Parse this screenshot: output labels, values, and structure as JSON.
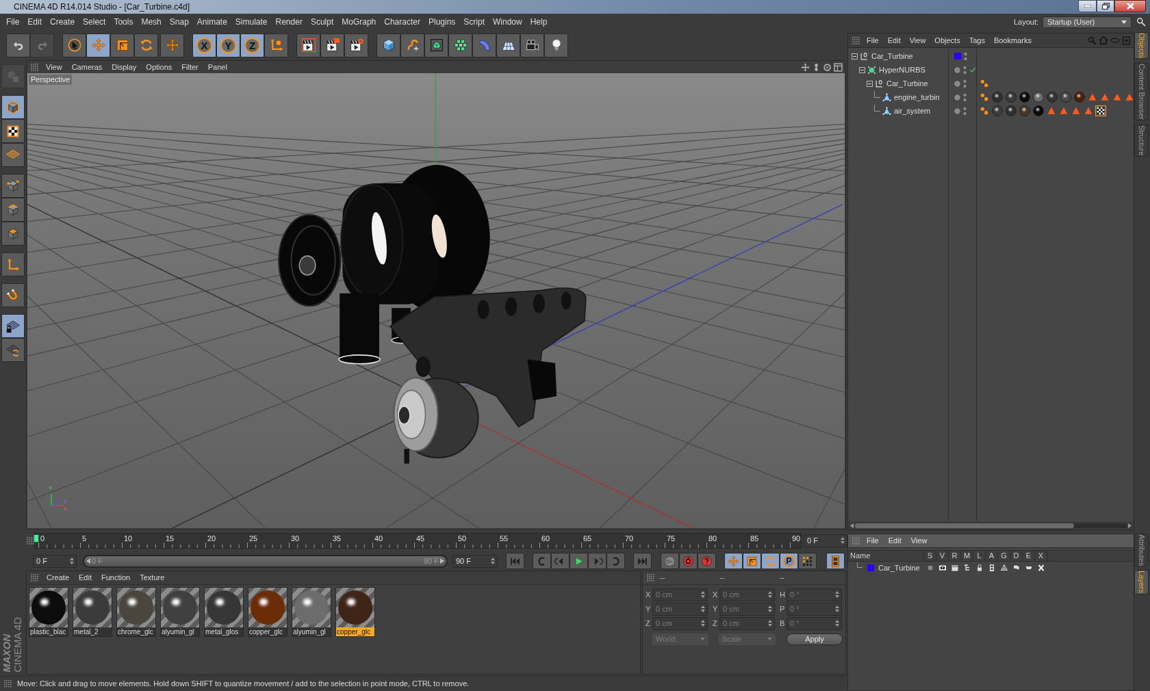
{
  "window": {
    "title": "CINEMA 4D R14.014 Studio - [Car_Turbine.c4d]"
  },
  "menu_bar": [
    "File",
    "Edit",
    "Create",
    "Select",
    "Tools",
    "Mesh",
    "Snap",
    "Animate",
    "Simulate",
    "Render",
    "Sculpt",
    "MoGraph",
    "Character",
    "Plugins",
    "Script",
    "Window",
    "Help"
  ],
  "layout": {
    "label": "Layout:",
    "value": "Startup (User)"
  },
  "toolbar": [
    [
      {
        "selected": false,
        "disabled": false
      },
      {
        "selected": false,
        "disabled": true
      }
    ],
    [
      {
        "selected": false,
        "disabled": false
      },
      {
        "selected": true,
        "disabled": false
      },
      {
        "selected": false,
        "disabled": false
      },
      {
        "selected": false,
        "disabled": false
      }
    ],
    [
      {
        "selected": false,
        "disabled": false
      }
    ],
    [
      {
        "label": "X",
        "selected": true,
        "disabled": false
      },
      {
        "label": "Y",
        "selected": true,
        "disabled": false
      },
      {
        "label": "Z",
        "selected": true,
        "disabled": false
      },
      {
        "selected": false,
        "disabled": false
      }
    ],
    [
      {
        "selected": false,
        "disabled": false
      },
      {
        "selected": false,
        "disabled": false
      },
      {
        "selected": false,
        "disabled": false
      }
    ],
    [
      {
        "selected": false,
        "disabled": false
      },
      {
        "selected": false,
        "disabled": false
      },
      {
        "selected": false,
        "disabled": false
      },
      {
        "selected": false,
        "disabled": false
      },
      {
        "selected": false,
        "disabled": false
      },
      {
        "selected": false,
        "disabled": false
      },
      {
        "selected": false,
        "disabled": false
      },
      {
        "selected": false,
        "disabled": false
      }
    ]
  ],
  "left_toolbar": [
    [
      {
        "selected": false,
        "disabled": true
      }
    ],
    [
      {
        "selected": true,
        "disabled": false
      },
      {
        "selected": false,
        "disabled": false
      },
      {
        "selected": false,
        "disabled": false
      }
    ],
    [
      {
        "selected": false,
        "disabled": false
      },
      {
        "selected": false,
        "disabled": false
      },
      {
        "selected": false,
        "disabled": false
      }
    ],
    [
      {
        "selected": false,
        "disabled": false
      }
    ],
    [
      {
        "selected": false,
        "disabled": false
      }
    ],
    [
      {
        "selected": true,
        "disabled": false
      },
      {
        "selected": false,
        "disabled": false
      }
    ]
  ],
  "logo": {
    "brand": "MAXON",
    "product": "CINEMA 4D"
  },
  "viewport": {
    "menu": [
      "View",
      "Cameras",
      "Display",
      "Options",
      "Filter",
      "Panel"
    ],
    "camera": "Perspective",
    "axis_labels": [
      "Y",
      "Z",
      "X"
    ]
  },
  "timeline": {
    "ticks": [
      "0",
      "5",
      "10",
      "15",
      "20",
      "25",
      "30",
      "35",
      "40",
      "45",
      "50",
      "55",
      "60",
      "65",
      "70",
      "75",
      "80",
      "85",
      "90"
    ],
    "playhead": {
      "level": 0
    },
    "current_frame": "0 F",
    "start_frame": "0 F",
    "range": {
      "start": "0 F",
      "end": "90 F",
      "level": 1
    },
    "end_frame": "90 F"
  },
  "playback": [
    [
      {
        "selected": false
      }
    ],
    [
      {
        "selected": false
      },
      {
        "selected": false
      },
      {
        "selected": false
      },
      {
        "selected": false
      },
      {
        "selected": false
      }
    ],
    [
      {
        "selected": false
      }
    ],
    [
      {
        "selected": false
      },
      {
        "selected": false
      },
      {
        "selected": false
      }
    ],
    [
      {
        "selected": true
      },
      {
        "selected": true
      },
      {
        "selected": true
      },
      {
        "label": "P",
        "selected": true
      },
      {
        "selected": false
      }
    ],
    [
      {
        "selected": true
      }
    ]
  ],
  "material_manager": {
    "menu": [
      "Create",
      "Edit",
      "Function",
      "Texture"
    ],
    "materials": [
      {
        "name": "plastic_blac",
        "color": "#0c0c0c",
        "selected": false
      },
      {
        "name": "metal_2",
        "color": "#3b3b3b",
        "selected": false
      },
      {
        "name": "chrome_glc",
        "color": "#4a463e",
        "selected": false
      },
      {
        "name": "alyumin_gl",
        "color": "#404040",
        "selected": false
      },
      {
        "name": "metal_glos",
        "color": "#363636",
        "selected": false
      },
      {
        "name": "copper_glc",
        "color": "#6b2c08",
        "selected": false
      },
      {
        "name": "alyumin_gl",
        "color": "#6c6c6c",
        "selected": false
      },
      {
        "name": "copper_glc",
        "color": "#3e2518",
        "selected": true
      }
    ]
  },
  "coordinates": {
    "disabled": true,
    "headers": [
      "--",
      "--",
      "--"
    ],
    "rows": [
      {
        "position_axis": "X",
        "position": "0 cm",
        "size_axis": "X",
        "size": "0 cm",
        "rotation_axis": "H",
        "rotation": "0 °"
      },
      {
        "position_axis": "Y",
        "position": "0 cm",
        "size_axis": "Y",
        "size": "0 cm",
        "rotation_axis": "P",
        "rotation": "0 °"
      },
      {
        "position_axis": "Z",
        "position": "0 cm",
        "size_axis": "Z",
        "size": "0 cm",
        "rotation_axis": "B",
        "rotation": "0 °"
      }
    ],
    "mode": "World",
    "transform": "Scale",
    "apply": "Apply"
  },
  "status_bar": "Move: Click and drag to move elements. Hold down SHIFT to quantize movement / add to the selection in point mode, CTRL to remove.",
  "object_manager": {
    "menu": [
      "File",
      "Edit",
      "View",
      "Objects",
      "Tags",
      "Bookmarks"
    ],
    "objects": [
      {
        "name": "Car_Turbine",
        "kind": "null",
        "color": "#2b00ff",
        "expanded": true,
        "children": [
          {
            "name": "HyperNURBS",
            "kind": "nurbs",
            "enabled": true,
            "expanded": true,
            "children": [
              {
                "name": "Car_Turbine",
                "kind": "null",
                "expanded": true,
                "tags": [
                  {
                    "kind": "phong",
                    "selected": false
                  }
                ],
                "children": [
                  {
                    "name": "engine_turbin",
                    "kind": "polygon",
                    "tags": [
                      {
                        "kind": "phong",
                        "selected": false
                      },
                      {
                        "kind": "material",
                        "color": "#2e2e2e",
                        "selected": false
                      },
                      {
                        "kind": "material",
                        "color": "#3a3a3a",
                        "selected": false
                      },
                      {
                        "kind": "material",
                        "color": "#0a0a0a",
                        "selected": false
                      },
                      {
                        "kind": "material",
                        "color": "#6a6a6a",
                        "selected": false
                      },
                      {
                        "kind": "material",
                        "color": "#343434",
                        "selected": false
                      },
                      {
                        "kind": "material",
                        "color": "#484848",
                        "selected": false
                      },
                      {
                        "kind": "material",
                        "color": "#4d1f08",
                        "selected": false
                      },
                      {
                        "kind": "selection",
                        "selected": false
                      },
                      {
                        "kind": "selection",
                        "selected": false
                      },
                      {
                        "kind": "selection",
                        "selected": false
                      },
                      {
                        "kind": "selection",
                        "selected": false
                      }
                    ]
                  },
                  {
                    "name": "air_system",
                    "kind": "polygon",
                    "tags": [
                      {
                        "kind": "phong",
                        "selected": false
                      },
                      {
                        "kind": "material",
                        "color": "#3c3c3c",
                        "selected": false
                      },
                      {
                        "kind": "material",
                        "color": "#2f2f2f",
                        "selected": false
                      },
                      {
                        "kind": "material",
                        "color": "#4a3826",
                        "selected": false
                      },
                      {
                        "kind": "material",
                        "color": "#0a0a0a",
                        "selected": false
                      },
                      {
                        "kind": "selection",
                        "selected": false
                      },
                      {
                        "kind": "selection",
                        "selected": false
                      },
                      {
                        "kind": "selection",
                        "selected": false
                      },
                      {
                        "kind": "selection",
                        "selected": false
                      },
                      {
                        "kind": "uvw",
                        "selected": true
                      }
                    ]
                  }
                ]
              }
            ]
          }
        ]
      }
    ]
  },
  "layer_manager": {
    "menu": [
      "File",
      "Edit",
      "View"
    ],
    "columns": [
      "Name",
      "S",
      "V",
      "R",
      "M",
      "L",
      "A",
      "G",
      "D",
      "E",
      "X"
    ],
    "layers": [
      {
        "name": "Car_Turbine",
        "color": "#2b00ff"
      }
    ]
  },
  "side_tabs": {
    "top": [
      {
        "label": "Objects",
        "selected": true
      },
      {
        "label": "Content Browser",
        "selected": false
      },
      {
        "label": "Structure",
        "selected": false
      }
    ],
    "bottom": [
      {
        "label": "Attributes",
        "selected": false
      },
      {
        "label": "Layers",
        "selected": true
      }
    ]
  }
}
